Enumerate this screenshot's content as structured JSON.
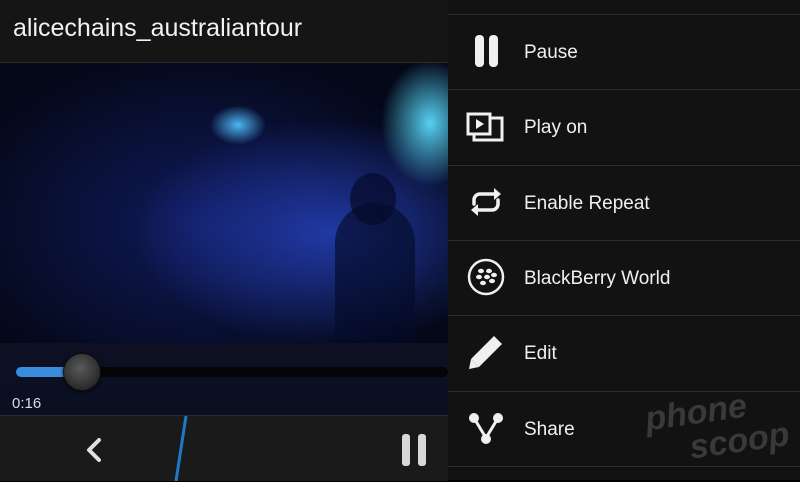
{
  "app": {
    "title": "alicechains_australiantour"
  },
  "player": {
    "elapsed": "0:16",
    "progress": 0.15,
    "accent_color": "#3a8ddc"
  },
  "action_bar": {
    "back_icon": "back-chevron-icon",
    "pause_icon": "pause-icon"
  },
  "menu": {
    "items": [
      {
        "label": "Pause",
        "icon": "pause-icon"
      },
      {
        "label": "Play on",
        "icon": "play-on-icon"
      },
      {
        "label": "Enable Repeat",
        "icon": "repeat-icon"
      },
      {
        "label": "BlackBerry World",
        "icon": "blackberry-world-icon"
      },
      {
        "label": "Edit",
        "icon": "pencil-icon"
      },
      {
        "label": "Share",
        "icon": "share-icon"
      }
    ]
  },
  "watermark": {
    "line1": "phone",
    "line2": "scoop"
  }
}
